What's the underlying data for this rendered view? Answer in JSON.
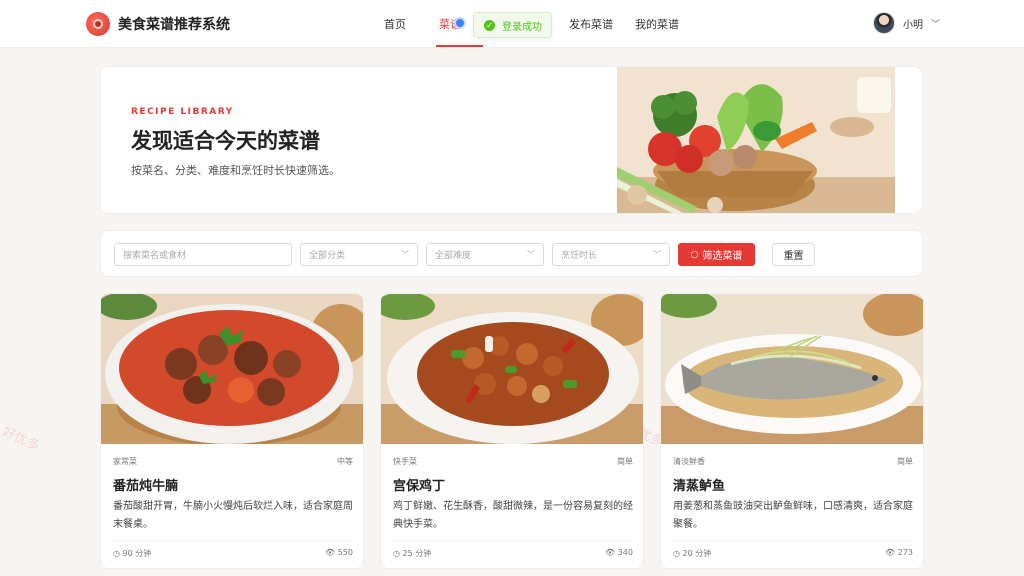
{
  "app": {
    "title": "美食菜谱推荐系统",
    "accent_color": "#e53935",
    "logo_icon": "tomato-icon"
  },
  "nav": {
    "items": [
      {
        "label": "首页",
        "active": false
      },
      {
        "label": "菜谱",
        "active": true
      },
      {
        "label": "发布菜谱",
        "active": false
      },
      {
        "label": "我的菜谱",
        "active": false
      }
    ]
  },
  "toast": {
    "text": "登录成功",
    "icon": "check-circle-icon",
    "color": "#52c41a"
  },
  "user": {
    "name": "小明",
    "avatar": "avatar-icon"
  },
  "hero": {
    "eyebrow": "RECIPE LIBRARY",
    "title": "发现适合今天的菜谱",
    "description": "按菜名、分类、难度和烹饪时长快速筛选。"
  },
  "filters": {
    "search_placeholder": "搜索菜名或食材",
    "category": "全部分类",
    "difficulty": "全部难度",
    "duration": "烹饪时长",
    "search_button": "筛选菜谱",
    "reset_button": "重置"
  },
  "recipes": [
    {
      "category": "家常菜",
      "difficulty": "中等",
      "title": "番茄炖牛腩",
      "description": "番茄酸甜开胃，牛腩小火慢炖后软烂入味，适合家庭周末餐桌。",
      "time": "90 分钟",
      "views": "550"
    },
    {
      "category": "快手菜",
      "difficulty": "简单",
      "title": "宫保鸡丁",
      "description": "鸡丁鲜嫩、花生酥香，酸甜微辣，是一份容易复刻的经典快手菜。",
      "time": "25 分钟",
      "views": "340"
    },
    {
      "category": "清淡鲜香",
      "difficulty": "简单",
      "title": "清蒸鲈鱼",
      "description": "用姜葱和蒸鱼豉油突出鲈鱼鲜味，口感清爽，适合家庭聚餐。",
      "time": "20 分钟",
      "views": "273"
    }
  ],
  "watermark": "好优多"
}
